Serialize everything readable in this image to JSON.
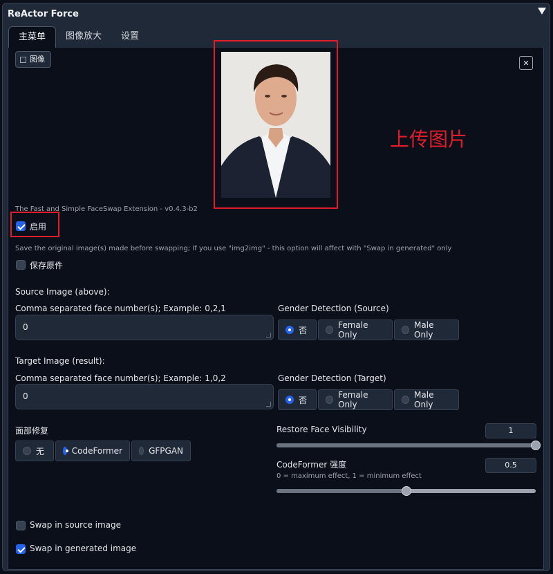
{
  "panel": {
    "title": "ReActor Force"
  },
  "tabs": [
    {
      "label": "主菜单",
      "active": true
    },
    {
      "label": "图像放大",
      "active": false
    },
    {
      "label": "设置",
      "active": false
    }
  ],
  "image_area": {
    "label": "图像",
    "close_label": "✕",
    "upload_hint": "上传图片"
  },
  "version_text": "The Fast and Simple FaceSwap Extension - v0.4.3-b2",
  "enable": {
    "label": "启用",
    "checked": true
  },
  "save_original": {
    "note": "Save the original image(s) made before swapping; If you use \"img2img\" - this option will affect with \"Swap in generated\" only",
    "label": "保存原件",
    "checked": false
  },
  "source": {
    "heading": "Source Image (above):",
    "faces_label": "Comma separated face number(s); Example: 0,2,1",
    "faces_value": "0",
    "gender_label": "Gender Detection (Source)",
    "gender_options": [
      "否",
      "Female Only",
      "Male Only"
    ],
    "gender_selected": 0
  },
  "target": {
    "heading": "Target Image (result):",
    "faces_label": "Comma separated face number(s); Example: 1,0,2",
    "faces_value": "0",
    "gender_label": "Gender Detection (Target)",
    "gender_options": [
      "否",
      "Female Only",
      "Male Only"
    ],
    "gender_selected": 0
  },
  "face_restore": {
    "label": "面部修复",
    "options": [
      "无",
      "CodeFormer",
      "GFPGAN"
    ],
    "selected": 1
  },
  "restore_visibility": {
    "label": "Restore Face Visibility",
    "value": "1",
    "fraction": 1.0
  },
  "codeformer_weight": {
    "label": "CodeFormer 强度",
    "hint": "0 = maximum effect, 1 = minimum effect",
    "value": "0.5",
    "fraction": 0.5
  },
  "swap_source": {
    "label": "Swap in source image",
    "checked": false
  },
  "swap_generated": {
    "label": "Swap in generated image",
    "checked": true
  },
  "colors": {
    "accent": "#2563eb",
    "annotation": "#e11d2b",
    "background": "#0b0f19",
    "panel": "#1f2937"
  }
}
